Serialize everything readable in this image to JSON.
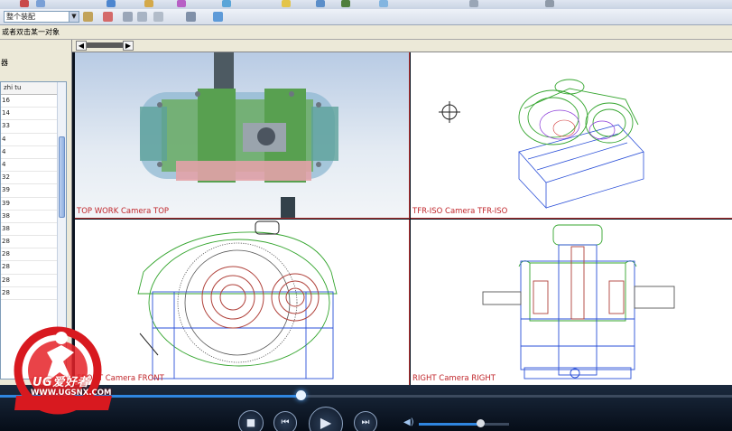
{
  "toolbar": {
    "selection_filter_value": "整个装配",
    "icons": [
      "play-icon",
      "gear-icon",
      "cube-icon",
      "part-icon",
      "shape-icon",
      "box-icon",
      "camera-icon",
      "layer-icon",
      "display-icon",
      "render-icon",
      "sphere-icon",
      "shade-icon"
    ]
  },
  "cue_line": "或者双击某一对象",
  "left_panel": {
    "title": "器",
    "column_header": "zhi tu",
    "rows": [
      "16",
      "14",
      "33",
      "4",
      "4",
      "4",
      "32",
      "39",
      "39",
      "38",
      "38",
      "28",
      "28",
      "28",
      "28",
      "28"
    ]
  },
  "nav": {
    "back": "◀",
    "forward": "▶"
  },
  "viewports": {
    "top": "TOP WORK Camera TOP",
    "tfr_iso": "TFR-ISO Camera TFR-ISO",
    "front": "FRONT Camera FRONT",
    "right": "RIGHT Camera RIGHT"
  },
  "player": {
    "progress": 0.41,
    "volume": 0.68,
    "stop": "■",
    "prev": "⏮",
    "play": "▶",
    "next": "⏭"
  },
  "watermark": {
    "brand": "UG爱好者",
    "url": "WWW.UGSNX.COM"
  },
  "colors": {
    "viewport_border": "#b03030",
    "label_text": "#c0262b",
    "player_accent": "#2f86e0"
  }
}
